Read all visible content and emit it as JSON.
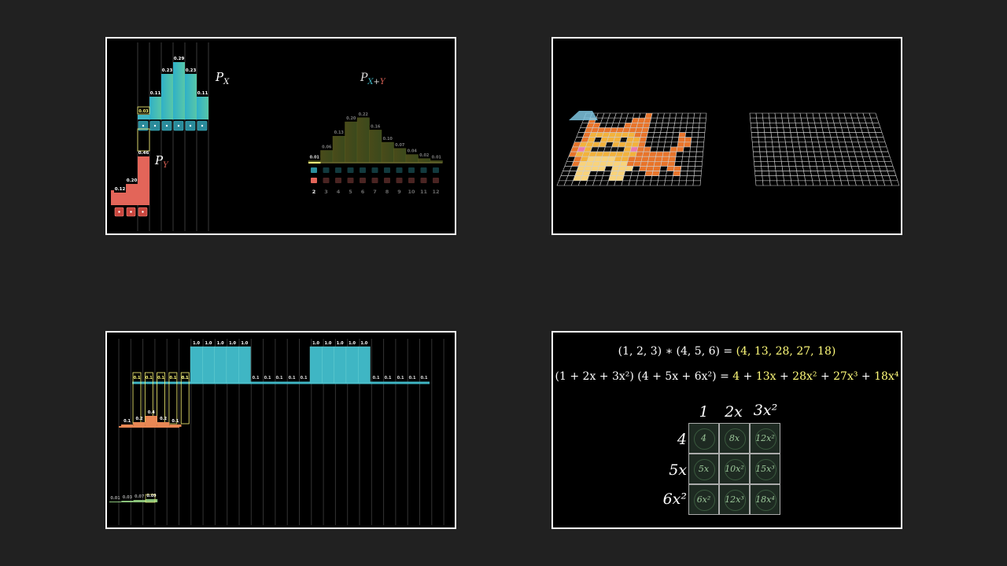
{
  "panel1": {
    "label_px": "P",
    "label_px_sub": "X",
    "label_py": "P",
    "label_py_sub": "Y",
    "label_sum": "P",
    "label_sum_sub_x": "X",
    "label_sum_sub_plus": "+",
    "label_sum_sub_y": "Y",
    "px_values": [
      "0.11",
      "0.23",
      "0.29",
      "0.23",
      "0.11",
      "0.03"
    ],
    "py_values": [
      "0.12",
      "0.20",
      "0.46"
    ],
    "sum_values": [
      "0.01",
      "0.06",
      "0.13",
      "0.20",
      "0.22",
      "0.16",
      "0.10",
      "0.07",
      "0.04",
      "0.02",
      "0.01"
    ],
    "sum_indices": [
      "2",
      "3",
      "4",
      "5",
      "6",
      "7",
      "8",
      "9",
      "10",
      "11",
      "12"
    ],
    "colors": {
      "teal": "#3fb6c4",
      "red": "#e36559",
      "olive": "#4d4e1d",
      "yellow": "#fffb7a"
    }
  },
  "panel4": {
    "eq1_left": "(1, 2, 3) ∗ (4, 5, 6) = ",
    "eq1_right": "(4, 13, 28, 27, 18)",
    "eq2_left": "(1 + 2x + 3x²) (4 + 5x + 6x²) = ",
    "eq2_terms": [
      "4",
      " + ",
      "13x",
      " + ",
      "28x²",
      " + ",
      "27x³",
      " + ",
      "18x⁴"
    ],
    "col_headers": [
      "1",
      "2x",
      "3x²"
    ],
    "row_headers": [
      "4",
      "5x",
      "6x²"
    ],
    "cells": [
      [
        "4",
        "8x",
        "12x²"
      ],
      [
        "5x",
        "10x²",
        "15x³"
      ],
      [
        "6x²",
        "12x³",
        "18x⁴"
      ]
    ]
  },
  "panel3": {
    "top_values": [
      "1.0",
      "1.0",
      "1.0",
      "1.0",
      "1.0"
    ],
    "mid_values": [
      "0.1",
      "0.1",
      "0.1",
      "0.1",
      "0.1"
    ],
    "small_values": [
      "0.1",
      "0.2",
      "0.4",
      "0.2",
      "0.1"
    ],
    "bottom_values": [
      "0.01",
      "0.03",
      "0.07",
      "0.09"
    ]
  }
}
